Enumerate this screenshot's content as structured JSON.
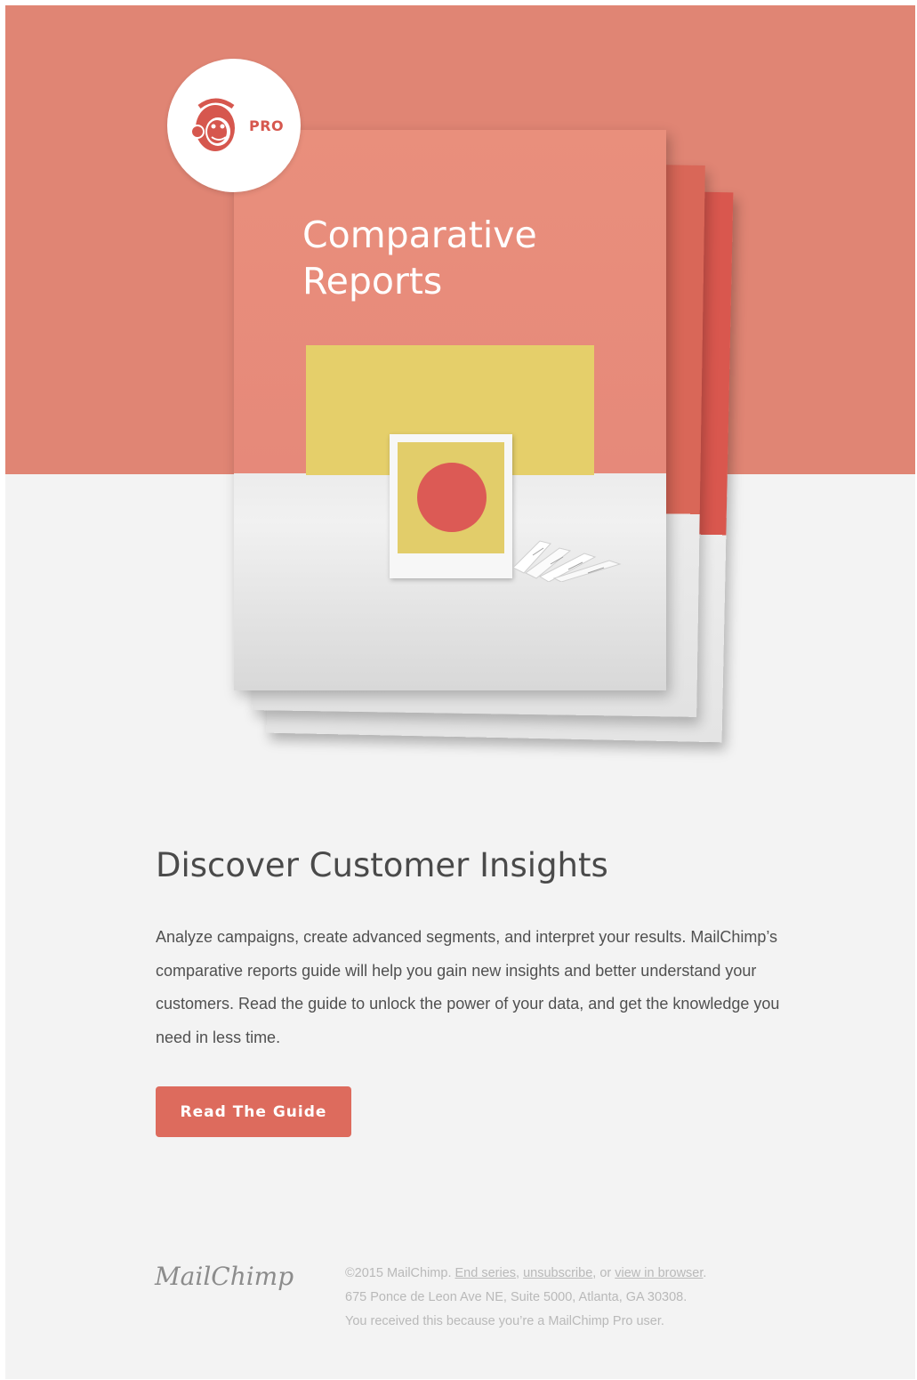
{
  "hero": {
    "badge_text": "PRO",
    "cover_title_line1": "Comparative",
    "cover_title_line2": "Reports",
    "colors": {
      "band": "#e08574",
      "yellow": "#e5cf6a",
      "red_dot": "#dc5a55"
    }
  },
  "content": {
    "headline": "Discover Customer Insights",
    "body": "Analyze campaigns, create advanced segments, and interpret your results. MailChimp’s comparative reports guide will help you gain new insights and better understand your customers. Read the guide to unlock the power of your data, and get the knowledge you need in less time.",
    "cta_label": "Read The Guide"
  },
  "footer": {
    "logo_text": "MailChimp",
    "copyright": "©2015 MailChimp.",
    "end_series": "End series",
    "unsubscribe": "unsubscribe",
    "or_text": ", or",
    "view_in_browser": "view in browser",
    "address": "675 Ponce de Leon Ave NE, Suite 5000, Atlanta, GA 30308.",
    "notice": "You received this because you’re a MailChimp Pro user."
  },
  "accent_color": "#dd6b5d"
}
